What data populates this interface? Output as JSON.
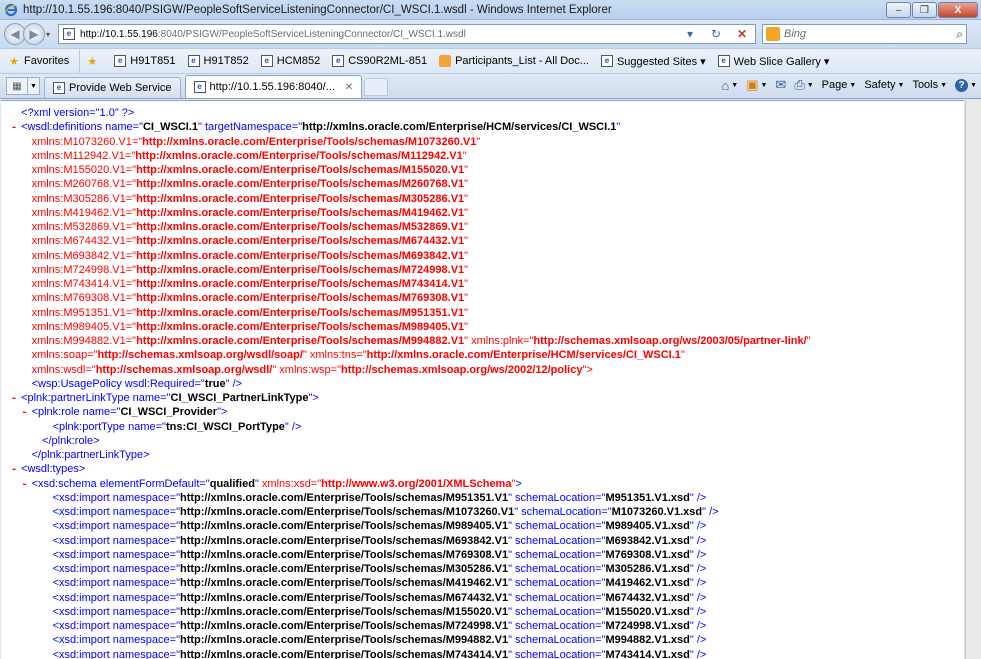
{
  "window": {
    "title": "http://10.1.55.196:8040/PSIGW/PeopleSoftServiceListeningConnector/CI_WSCI.1.wsdl - Windows Internet Explorer",
    "minimize": "–",
    "restore": "❐",
    "close": "X"
  },
  "address": {
    "host": "http://10.1.55.196",
    "path": ":8040/PSIGW/PeopleSoftServiceListeningConnector/CI_WSCI.1.wsdl",
    "refresh": "↻",
    "stop": "✕",
    "nav_drop": "▾"
  },
  "search": {
    "placeholder": "Bing",
    "go": "⌕"
  },
  "favorites": {
    "label": "Favorites",
    "items": [
      {
        "label": "H91T851"
      },
      {
        "label": "H91T852"
      },
      {
        "label": "HCM852"
      },
      {
        "label": "CS90R2ML-851"
      },
      {
        "label": "Participants_List - All Doc..."
      },
      {
        "label": "Suggested Sites ▾"
      },
      {
        "label": "Web Slice Gallery ▾"
      }
    ]
  },
  "tabs": [
    {
      "label": "Provide Web Service"
    },
    {
      "label": "http://10.1.55.196:8040/..."
    }
  ],
  "commands": {
    "page": "Page",
    "safety": "Safety",
    "tools": "Tools",
    "help": "?"
  },
  "icons": {
    "ie": "ie-logo-icon",
    "back": "back-arrow-icon",
    "forward": "forward-arrow-icon",
    "home": "home-icon",
    "feeds": "rss-feed-icon",
    "mail": "mail-icon",
    "print": "printer-icon",
    "favorites": "star-icon",
    "add-favorite": "add-favorite-icon",
    "quick-tabs": "quick-tabs-icon"
  },
  "colors": {
    "tag": "#0000ff",
    "marker": "#ff0000",
    "namespace": "#ff0000",
    "value": "#000000"
  },
  "xml": {
    "lines": [
      {
        "indent": 0,
        "marker": "",
        "parts": [
          [
            "b",
            "<?xml version=\"1.0\" ?>"
          ]
        ]
      },
      {
        "indent": 0,
        "marker": "-",
        "parts": [
          [
            "b",
            "<wsdl:definitions name=\""
          ],
          [
            "av",
            "CI_WSCI.1"
          ],
          [
            "b",
            "\" targetNamespace=\""
          ],
          [
            "av",
            "http://xmlns.oracle.com/Enterprise/HCM/services/CI_WSCI.1"
          ],
          [
            "b",
            "\""
          ]
        ]
      },
      {
        "indent": 1,
        "marker": "",
        "parts": [
          [
            "ns",
            "xmlns:M1073260.V1=\""
          ],
          [
            "nsv",
            "http://xmlns.oracle.com/Enterprise/Tools/schemas/M1073260.V1"
          ],
          [
            "ns",
            "\""
          ]
        ]
      },
      {
        "indent": 1,
        "marker": "",
        "parts": [
          [
            "ns",
            "xmlns:M112942.V1=\""
          ],
          [
            "nsv",
            "http://xmlns.oracle.com/Enterprise/Tools/schemas/M112942.V1"
          ],
          [
            "ns",
            "\""
          ]
        ]
      },
      {
        "indent": 1,
        "marker": "",
        "parts": [
          [
            "ns",
            "xmlns:M155020.V1=\""
          ],
          [
            "nsv",
            "http://xmlns.oracle.com/Enterprise/Tools/schemas/M155020.V1"
          ],
          [
            "ns",
            "\""
          ]
        ]
      },
      {
        "indent": 1,
        "marker": "",
        "parts": [
          [
            "ns",
            "xmlns:M260768.V1=\""
          ],
          [
            "nsv",
            "http://xmlns.oracle.com/Enterprise/Tools/schemas/M260768.V1"
          ],
          [
            "ns",
            "\""
          ]
        ]
      },
      {
        "indent": 1,
        "marker": "",
        "parts": [
          [
            "ns",
            "xmlns:M305286.V1=\""
          ],
          [
            "nsv",
            "http://xmlns.oracle.com/Enterprise/Tools/schemas/M305286.V1"
          ],
          [
            "ns",
            "\""
          ]
        ]
      },
      {
        "indent": 1,
        "marker": "",
        "parts": [
          [
            "ns",
            "xmlns:M419462.V1=\""
          ],
          [
            "nsv",
            "http://xmlns.oracle.com/Enterprise/Tools/schemas/M419462.V1"
          ],
          [
            "ns",
            "\""
          ]
        ]
      },
      {
        "indent": 1,
        "marker": "",
        "parts": [
          [
            "ns",
            "xmlns:M532869.V1=\""
          ],
          [
            "nsv",
            "http://xmlns.oracle.com/Enterprise/Tools/schemas/M532869.V1"
          ],
          [
            "ns",
            "\""
          ]
        ]
      },
      {
        "indent": 1,
        "marker": "",
        "parts": [
          [
            "ns",
            "xmlns:M674432.V1=\""
          ],
          [
            "nsv",
            "http://xmlns.oracle.com/Enterprise/Tools/schemas/M674432.V1"
          ],
          [
            "ns",
            "\""
          ]
        ]
      },
      {
        "indent": 1,
        "marker": "",
        "parts": [
          [
            "ns",
            "xmlns:M693842.V1=\""
          ],
          [
            "nsv",
            "http://xmlns.oracle.com/Enterprise/Tools/schemas/M693842.V1"
          ],
          [
            "ns",
            "\""
          ]
        ]
      },
      {
        "indent": 1,
        "marker": "",
        "parts": [
          [
            "ns",
            "xmlns:M724998.V1=\""
          ],
          [
            "nsv",
            "http://xmlns.oracle.com/Enterprise/Tools/schemas/M724998.V1"
          ],
          [
            "ns",
            "\""
          ]
        ]
      },
      {
        "indent": 1,
        "marker": "",
        "parts": [
          [
            "ns",
            "xmlns:M743414.V1=\""
          ],
          [
            "nsv",
            "http://xmlns.oracle.com/Enterprise/Tools/schemas/M743414.V1"
          ],
          [
            "ns",
            "\""
          ]
        ]
      },
      {
        "indent": 1,
        "marker": "",
        "parts": [
          [
            "ns",
            "xmlns:M769308.V1=\""
          ],
          [
            "nsv",
            "http://xmlns.oracle.com/Enterprise/Tools/schemas/M769308.V1"
          ],
          [
            "ns",
            "\""
          ]
        ]
      },
      {
        "indent": 1,
        "marker": "",
        "parts": [
          [
            "ns",
            "xmlns:M951351.V1=\""
          ],
          [
            "nsv",
            "http://xmlns.oracle.com/Enterprise/Tools/schemas/M951351.V1"
          ],
          [
            "ns",
            "\""
          ]
        ]
      },
      {
        "indent": 1,
        "marker": "",
        "parts": [
          [
            "ns",
            "xmlns:M989405.V1=\""
          ],
          [
            "nsv",
            "http://xmlns.oracle.com/Enterprise/Tools/schemas/M989405.V1"
          ],
          [
            "ns",
            "\""
          ]
        ]
      },
      {
        "indent": 1,
        "marker": "",
        "parts": [
          [
            "ns",
            "xmlns:M994882.V1=\""
          ],
          [
            "nsv",
            "http://xmlns.oracle.com/Enterprise/Tools/schemas/M994882.V1"
          ],
          [
            "ns",
            "\" xmlns:plnk=\""
          ],
          [
            "nsv",
            "http://schemas.xmlsoap.org/ws/2003/05/partner-link/"
          ],
          [
            "ns",
            "\""
          ]
        ]
      },
      {
        "indent": 1,
        "marker": "",
        "parts": [
          [
            "ns",
            "xmlns:soap=\""
          ],
          [
            "nsv",
            "http://schemas.xmlsoap.org/wsdl/soap/"
          ],
          [
            "ns",
            "\" xmlns:tns=\""
          ],
          [
            "nsv",
            "http://xmlns.oracle.com/Enterprise/HCM/services/CI_WSCI.1"
          ],
          [
            "ns",
            "\""
          ]
        ]
      },
      {
        "indent": 1,
        "marker": "",
        "parts": [
          [
            "ns",
            "xmlns:wsdl=\""
          ],
          [
            "nsv",
            "http://schemas.xmlsoap.org/wsdl/"
          ],
          [
            "ns",
            "\" xmlns:wsp=\""
          ],
          [
            "nsv",
            "http://schemas.xmlsoap.org/ws/2002/12/policy"
          ],
          [
            "ns",
            "\">"
          ]
        ]
      },
      {
        "indent": 1,
        "marker": "",
        "parts": [
          [
            "b",
            "<wsp:UsagePolicy wsdl:Required=\""
          ],
          [
            "av",
            "true"
          ],
          [
            "b",
            "\" />"
          ]
        ]
      },
      {
        "indent": 0,
        "marker": "-",
        "parts": [
          [
            "b",
            "<plnk:partnerLinkType name=\""
          ],
          [
            "av",
            "CI_WSCI_PartnerLinkType"
          ],
          [
            "b",
            "\">"
          ]
        ]
      },
      {
        "indent": 1,
        "marker": "-",
        "parts": [
          [
            "b",
            "<plnk:role name=\""
          ],
          [
            "av",
            "CI_WSCI_Provider"
          ],
          [
            "b",
            "\">"
          ]
        ]
      },
      {
        "indent": 3,
        "marker": "",
        "parts": [
          [
            "b",
            "<plnk:portType name=\""
          ],
          [
            "av",
            "tns:CI_WSCI_PortType"
          ],
          [
            "b",
            "\" />"
          ]
        ]
      },
      {
        "indent": 2,
        "marker": "",
        "parts": [
          [
            "b",
            "</plnk:role>"
          ]
        ]
      },
      {
        "indent": 1,
        "marker": "",
        "parts": [
          [
            "b",
            "</plnk:partnerLinkType>"
          ]
        ]
      },
      {
        "indent": 0,
        "marker": "-",
        "parts": [
          [
            "b",
            "<wsdl:types>"
          ]
        ]
      },
      {
        "indent": 1,
        "marker": "-",
        "parts": [
          [
            "b",
            "<xsd:schema elementFormDefault=\""
          ],
          [
            "av",
            "qualified"
          ],
          [
            "b",
            "\" "
          ],
          [
            "ns",
            "xmlns:xsd=\""
          ],
          [
            "nsv",
            "http://www.w3.org/2001/XMLSchema"
          ],
          [
            "ns",
            "\""
          ],
          [
            "b",
            ">"
          ]
        ]
      },
      {
        "indent": 3,
        "marker": "",
        "parts": [
          [
            "b",
            "<xsd:import namespace=\""
          ],
          [
            "av",
            "http://xmlns.oracle.com/Enterprise/Tools/schemas/M951351.V1"
          ],
          [
            "b",
            "\" schemaLocation=\""
          ],
          [
            "av",
            "M951351.V1.xsd"
          ],
          [
            "b",
            "\" />"
          ]
        ]
      },
      {
        "indent": 3,
        "marker": "",
        "parts": [
          [
            "b",
            "<xsd:import namespace=\""
          ],
          [
            "av",
            "http://xmlns.oracle.com/Enterprise/Tools/schemas/M1073260.V1"
          ],
          [
            "b",
            "\" schemaLocation=\""
          ],
          [
            "av",
            "M1073260.V1.xsd"
          ],
          [
            "b",
            "\" />"
          ]
        ]
      },
      {
        "indent": 3,
        "marker": "",
        "parts": [
          [
            "b",
            "<xsd:import namespace=\""
          ],
          [
            "av",
            "http://xmlns.oracle.com/Enterprise/Tools/schemas/M989405.V1"
          ],
          [
            "b",
            "\" schemaLocation=\""
          ],
          [
            "av",
            "M989405.V1.xsd"
          ],
          [
            "b",
            "\" />"
          ]
        ]
      },
      {
        "indent": 3,
        "marker": "",
        "parts": [
          [
            "b",
            "<xsd:import namespace=\""
          ],
          [
            "av",
            "http://xmlns.oracle.com/Enterprise/Tools/schemas/M693842.V1"
          ],
          [
            "b",
            "\" schemaLocation=\""
          ],
          [
            "av",
            "M693842.V1.xsd"
          ],
          [
            "b",
            "\" />"
          ]
        ]
      },
      {
        "indent": 3,
        "marker": "",
        "parts": [
          [
            "b",
            "<xsd:import namespace=\""
          ],
          [
            "av",
            "http://xmlns.oracle.com/Enterprise/Tools/schemas/M769308.V1"
          ],
          [
            "b",
            "\" schemaLocation=\""
          ],
          [
            "av",
            "M769308.V1.xsd"
          ],
          [
            "b",
            "\" />"
          ]
        ]
      },
      {
        "indent": 3,
        "marker": "",
        "parts": [
          [
            "b",
            "<xsd:import namespace=\""
          ],
          [
            "av",
            "http://xmlns.oracle.com/Enterprise/Tools/schemas/M305286.V1"
          ],
          [
            "b",
            "\" schemaLocation=\""
          ],
          [
            "av",
            "M305286.V1.xsd"
          ],
          [
            "b",
            "\" />"
          ]
        ]
      },
      {
        "indent": 3,
        "marker": "",
        "parts": [
          [
            "b",
            "<xsd:import namespace=\""
          ],
          [
            "av",
            "http://xmlns.oracle.com/Enterprise/Tools/schemas/M419462.V1"
          ],
          [
            "b",
            "\" schemaLocation=\""
          ],
          [
            "av",
            "M419462.V1.xsd"
          ],
          [
            "b",
            "\" />"
          ]
        ]
      },
      {
        "indent": 3,
        "marker": "",
        "parts": [
          [
            "b",
            "<xsd:import namespace=\""
          ],
          [
            "av",
            "http://xmlns.oracle.com/Enterprise/Tools/schemas/M674432.V1"
          ],
          [
            "b",
            "\" schemaLocation=\""
          ],
          [
            "av",
            "M674432.V1.xsd"
          ],
          [
            "b",
            "\" />"
          ]
        ]
      },
      {
        "indent": 3,
        "marker": "",
        "parts": [
          [
            "b",
            "<xsd:import namespace=\""
          ],
          [
            "av",
            "http://xmlns.oracle.com/Enterprise/Tools/schemas/M155020.V1"
          ],
          [
            "b",
            "\" schemaLocation=\""
          ],
          [
            "av",
            "M155020.V1.xsd"
          ],
          [
            "b",
            "\" />"
          ]
        ]
      },
      {
        "indent": 3,
        "marker": "",
        "parts": [
          [
            "b",
            "<xsd:import namespace=\""
          ],
          [
            "av",
            "http://xmlns.oracle.com/Enterprise/Tools/schemas/M724998.V1"
          ],
          [
            "b",
            "\" schemaLocation=\""
          ],
          [
            "av",
            "M724998.V1.xsd"
          ],
          [
            "b",
            "\" />"
          ]
        ]
      },
      {
        "indent": 3,
        "marker": "",
        "parts": [
          [
            "b",
            "<xsd:import namespace=\""
          ],
          [
            "av",
            "http://xmlns.oracle.com/Enterprise/Tools/schemas/M994882.V1"
          ],
          [
            "b",
            "\" schemaLocation=\""
          ],
          [
            "av",
            "M994882.V1.xsd"
          ],
          [
            "b",
            "\" />"
          ]
        ]
      },
      {
        "indent": 3,
        "marker": "",
        "parts": [
          [
            "b",
            "<xsd:import namespace=\""
          ],
          [
            "av",
            "http://xmlns.oracle.com/Enterprise/Tools/schemas/M743414.V1"
          ],
          [
            "b",
            "\" schemaLocation=\""
          ],
          [
            "av",
            "M743414.V1.xsd"
          ],
          [
            "b",
            "\" />"
          ]
        ]
      }
    ]
  }
}
